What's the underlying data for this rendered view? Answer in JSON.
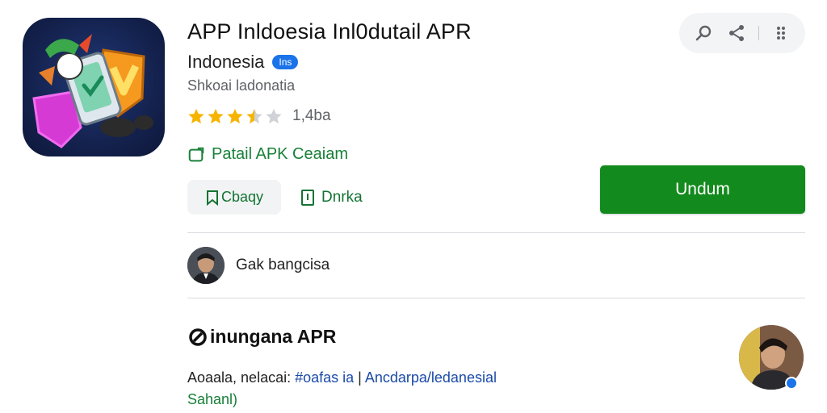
{
  "app": {
    "title": "APP Inldoesia Inl0dutail APR",
    "developer": "Indonesia",
    "developer_badge": "Ins",
    "category": "Shkoai ladonatia",
    "rating_stars": 3.5,
    "rating_count": "1,4ba",
    "verified_label": "Patail APK Ceaiam",
    "chip_primary_label": "Cbaqy",
    "chip_secondary_label": "Dnrka",
    "install_label": "Undum"
  },
  "toolbar": {
    "icons": [
      "search-icon",
      "share-icon",
      "more-vert-icon"
    ]
  },
  "review": {
    "text": "Gak bangcisa"
  },
  "section": {
    "title": "inungana APR",
    "desc_plain": "Aoaala, nelacai: ",
    "desc_tag": "#oafas ia",
    "desc_link": "Ancdarpa/ledanesial",
    "desc_line2": "Sahanl)"
  },
  "colors": {
    "primary_green": "#138a1d",
    "text_green": "#188038",
    "star": "#f6b400",
    "badge_blue": "#1a73e8"
  }
}
